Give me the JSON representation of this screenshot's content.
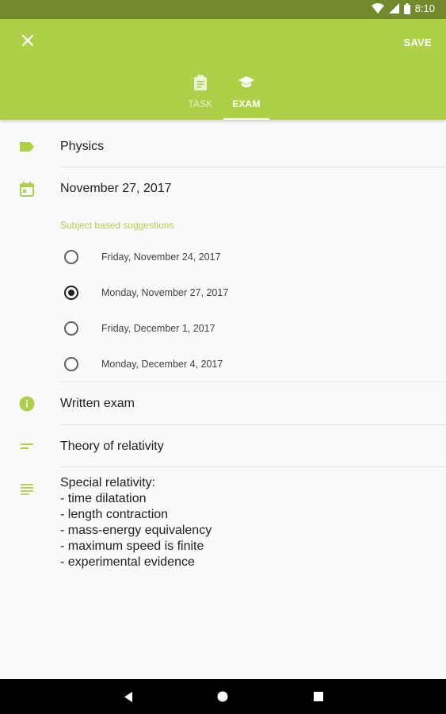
{
  "status_bar": {
    "time": "8:10",
    "icons": [
      "wifi-icon",
      "signal-icon",
      "battery-icon"
    ]
  },
  "app_bar": {
    "close_icon": "close-icon",
    "save_label": "SAVE",
    "tabs": [
      {
        "label": "TASK",
        "icon": "clipboard-icon",
        "active": false
      },
      {
        "label": "EXAM",
        "icon": "graduation-cap-icon",
        "active": true
      }
    ]
  },
  "form": {
    "subject": "Physics",
    "date": "November 27, 2017",
    "suggestions_title": "Subject based suggestions",
    "suggestions": [
      {
        "label": "Friday, November 24, 2017",
        "selected": false
      },
      {
        "label": "Monday, November 27, 2017",
        "selected": true
      },
      {
        "label": "Friday, December 1, 2017",
        "selected": false
      },
      {
        "label": "Monday, December 4, 2017",
        "selected": false
      }
    ],
    "exam_type": "Written exam",
    "topic": "Theory of relativity",
    "notes": "Special relativity:\n- time dilatation\n- length contraction\n- mass-energy equivalency\n- maximum speed is finite\n- experimental evidence"
  },
  "colors": {
    "accent": "#aecf48",
    "status_bar": "#718a2c",
    "background": "#fafafa"
  },
  "nav": {
    "buttons": [
      "back-icon",
      "home-icon",
      "recents-icon"
    ]
  }
}
